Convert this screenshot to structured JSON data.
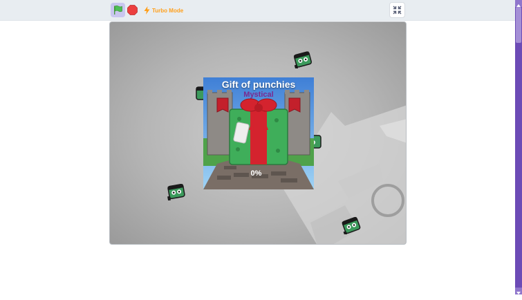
{
  "menu": {
    "turbo_label": "Turbo Mode",
    "icons": [
      "green-flag-icon",
      "stop-icon",
      "lightning-icon",
      "exit-fullscreen-icon"
    ]
  },
  "popup": {
    "title": "Gift of punchies",
    "rarity": "Mystical",
    "progress_text": "0%",
    "progress_value": 0
  },
  "colors": {
    "flag_button_bg": "#c9c6ef",
    "stop": "#ec3f3f",
    "turbo": "#ff9f1a",
    "rarity": "#7a2a8f",
    "gift_box": "#3fae5a",
    "ribbon": "#d4232e",
    "sprite_green": "#3c9a5c",
    "scrollbar": "#6c4bb6"
  }
}
